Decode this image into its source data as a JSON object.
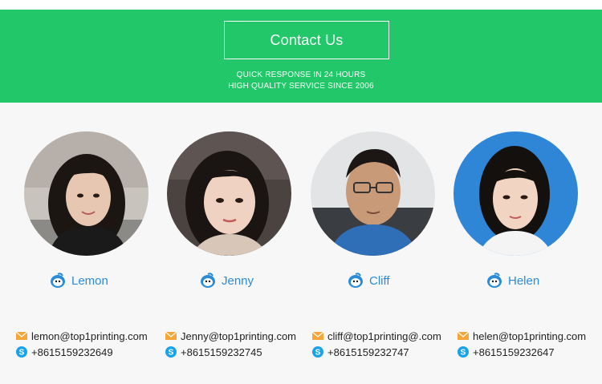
{
  "header": {
    "button_label": "Contact Us",
    "tagline_1": "QUICK RESPONSE IN 24 HOURS",
    "tagline_2": "HIGH QUALITY SERVICE SINCE 2006"
  },
  "contacts": [
    {
      "name": "Lemon",
      "email": "lemon@top1printing.com",
      "skype": "+8615159232649"
    },
    {
      "name": "Jenny",
      "email": "Jenny@top1printing.com",
      "skype": "+8615159232745"
    },
    {
      "name": "Cliff",
      "email": "cliff@top1printing@.com",
      "skype": "+8615159232747"
    },
    {
      "name": "Helen",
      "email": "helen@top1printing.com",
      "skype": "+8615159232647"
    }
  ],
  "colors": {
    "banner": "#21c769",
    "name_text": "#2a8bd8",
    "email_icon": "#f4a63a",
    "skype_icon": "#1aa3e8"
  },
  "icons": {
    "chat": "qq-penguin-icon",
    "email": "envelope-icon",
    "phone": "skype-icon"
  }
}
